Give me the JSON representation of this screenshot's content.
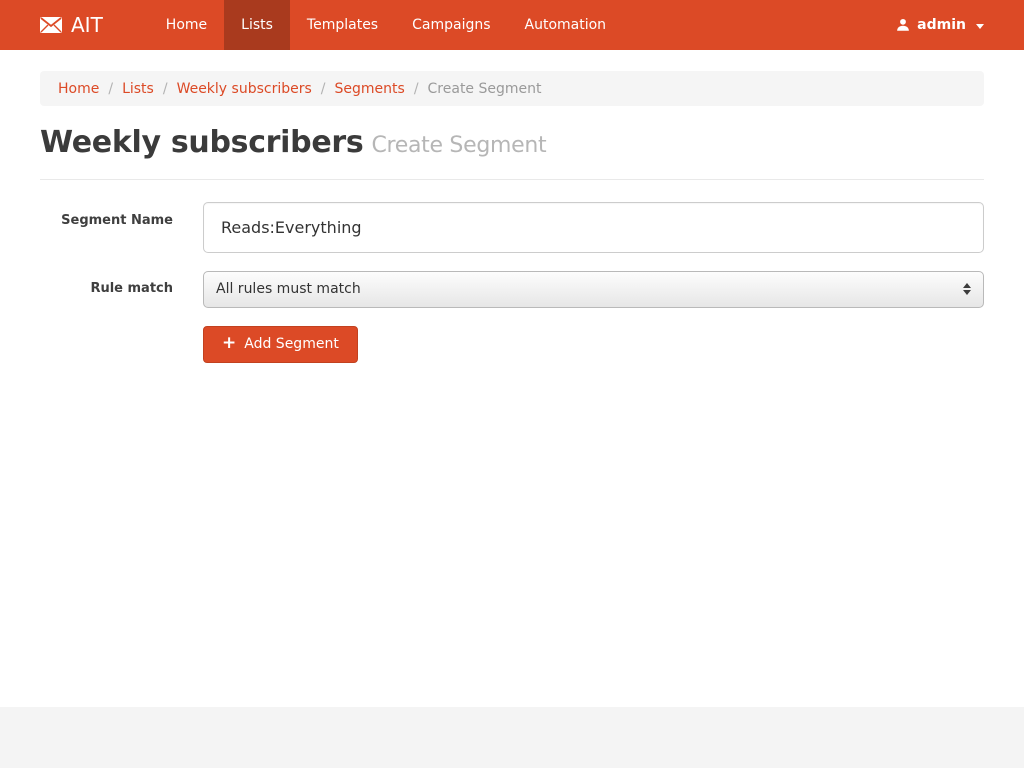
{
  "navbar": {
    "brand": "AIT",
    "items": [
      {
        "label": "Home",
        "active": false
      },
      {
        "label": "Lists",
        "active": true
      },
      {
        "label": "Templates",
        "active": false
      },
      {
        "label": "Campaigns",
        "active": false
      },
      {
        "label": "Automation",
        "active": false
      }
    ],
    "user": {
      "label": "admin"
    }
  },
  "breadcrumb": {
    "items": [
      "Home",
      "Lists",
      "Weekly subscribers",
      "Segments"
    ],
    "separator": "/",
    "current": "Create Segment"
  },
  "page": {
    "title": "Weekly subscribers",
    "subtitle": "Create Segment"
  },
  "form": {
    "segment_name": {
      "label": "Segment Name",
      "value": "Reads:Everything"
    },
    "rule_match": {
      "label": "Rule match",
      "value": "All rules must match"
    },
    "submit": {
      "label": "Add Segment",
      "icon": "+"
    }
  },
  "colors": {
    "primary": "#dc4a26",
    "primary_dark": "#a93a1e",
    "breadcrumb_bg": "#f5f5f5",
    "footer_bg": "#f4f4f4"
  }
}
